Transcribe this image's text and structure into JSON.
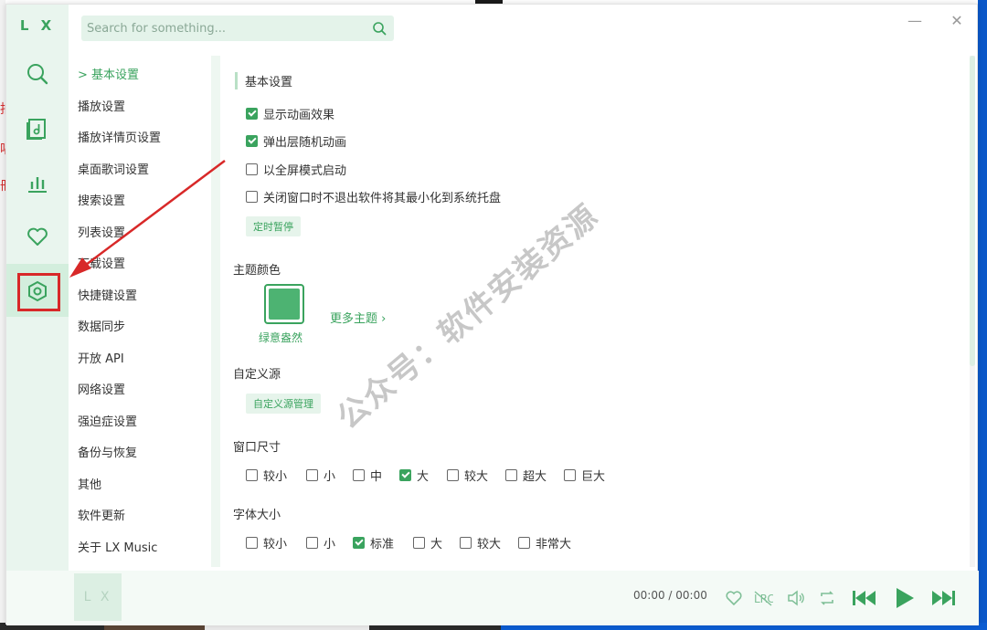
{
  "app": {
    "logo": "L X",
    "thumb_logo": "L X"
  },
  "search": {
    "placeholder": "Search for something..."
  },
  "background_fragments": [
    "拍",
    "唱",
    "冊"
  ],
  "nav": {
    "items": [
      "基本设置",
      "播放设置",
      "播放详情页设置",
      "桌面歌词设置",
      "搜索设置",
      "列表设置",
      "下载设置",
      "快捷键设置",
      "数据同步",
      "开放 API",
      "网络设置",
      "强迫症设置",
      "备份与恢复",
      "其他",
      "软件更新",
      "关于 LX Music"
    ],
    "active_index": 0,
    "active_marker": ">"
  },
  "basic": {
    "title": "基本设置",
    "options": [
      {
        "label": "显示动画效果",
        "checked": true
      },
      {
        "label": "弹出层随机动画",
        "checked": true
      },
      {
        "label": "以全屏模式启动",
        "checked": false
      },
      {
        "label": "关闭窗口时不退出软件将其最小化到系统托盘",
        "checked": false
      }
    ],
    "timer_button": "定时暂停"
  },
  "theme": {
    "title": "主题颜色",
    "current": "绿意盎然",
    "more": "更多主题",
    "color": "#4db372"
  },
  "source": {
    "title": "自定义源",
    "manage_button": "自定义源管理"
  },
  "window_size": {
    "title": "窗口尺寸",
    "options": [
      {
        "label": "较小",
        "checked": false
      },
      {
        "label": "小",
        "checked": false
      },
      {
        "label": "中",
        "checked": false
      },
      {
        "label": "大",
        "checked": true
      },
      {
        "label": "较大",
        "checked": false
      },
      {
        "label": "超大",
        "checked": false
      },
      {
        "label": "巨大",
        "checked": false
      }
    ]
  },
  "font_size": {
    "title": "字体大小",
    "options": [
      {
        "label": "较小",
        "checked": false
      },
      {
        "label": "小",
        "checked": false
      },
      {
        "label": "标准",
        "checked": true
      },
      {
        "label": "大",
        "checked": false
      },
      {
        "label": "较大",
        "checked": false
      },
      {
        "label": "非常大",
        "checked": false
      }
    ]
  },
  "player": {
    "time": "00:00 / 00:00"
  },
  "watermark": "公众号：软件安装资源",
  "colors": {
    "accent": "#3aa35e",
    "highlight_red": "#d82828"
  },
  "icons": [
    "search-icon",
    "music-library-icon",
    "chart-icon",
    "heart-icon",
    "settings-icon",
    "minimize-icon",
    "close-icon",
    "like-icon",
    "lyric-off-icon",
    "volume-icon",
    "repeat-icon",
    "prev-icon",
    "play-icon",
    "next-icon"
  ]
}
